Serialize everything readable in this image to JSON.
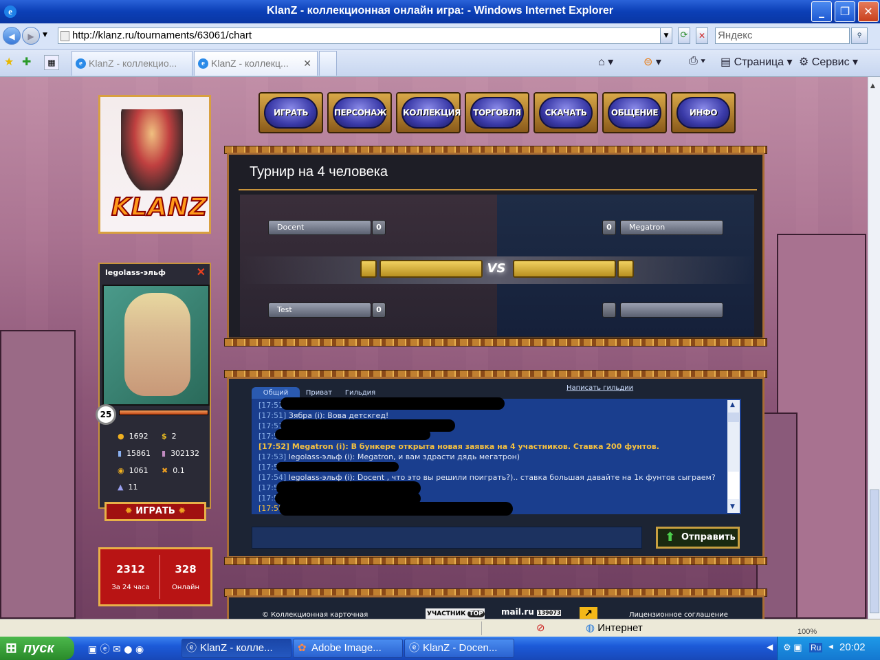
{
  "window": {
    "title": "KlanZ - коллекционная онлайн игра: - Windows Internet Explorer"
  },
  "address": {
    "url": "http://klanz.ru/tournaments/63061/chart",
    "search_placeholder": "Яндекс"
  },
  "tabs": [
    {
      "label": "KlanZ - коллекцио..."
    },
    {
      "label": "KlanZ - коллекц..."
    }
  ],
  "toolbar": {
    "page": "Страница",
    "service": "Сервис"
  },
  "game": {
    "menu": [
      "ИГРАТЬ",
      "ПЕРСОНАЖ",
      "КОЛЛЕКЦИЯ",
      "ТОРГОВЛЯ",
      "СКАЧАТЬ",
      "ОБЩЕНИЕ",
      "ИНФО"
    ],
    "logo": "KLANZ",
    "tournament_title": "Турнир на 4 человека",
    "bracket": {
      "left": [
        {
          "name": "Docent",
          "score": "0"
        },
        {
          "name": "Test",
          "score": "0"
        }
      ],
      "right": [
        {
          "name": "Megatron",
          "score": "0"
        },
        {
          "name": "",
          "score": ""
        }
      ],
      "vs": "VS"
    },
    "profile": {
      "name": "legolass-эльф",
      "level": "25",
      "stats": {
        "s1": "1692",
        "s2": "2",
        "s3": "15861",
        "s4": "302132",
        "s5": "1061",
        "s6": "0.1",
        "s7": "11"
      },
      "play_button": "ИГРАТЬ"
    },
    "counters": {
      "day_value": "2312",
      "day_label": "За 24 часа",
      "online_value": "328",
      "online_label": "Онлайн"
    },
    "chat": {
      "tabs": [
        "Общий",
        "Приват",
        "Гильдия"
      ],
      "guild_link": "Написать гильдии",
      "lines": [
        {
          "t": "[17:51]",
          "text": "",
          "hl": false
        },
        {
          "t": "[17:51]",
          "text": "Зябра (i): Вова детскгед!",
          "hl": false
        },
        {
          "t": "[17:51]",
          "text": "",
          "hl": false
        },
        {
          "t": "[17:51",
          "text": "",
          "hl": false
        },
        {
          "t": "[17:52]",
          "text": "Megatron (i): В бункере открыта новая заявка на 4 участников. Ставка 200 фунтов.",
          "hl": true
        },
        {
          "t": "[17:53]",
          "text": "legolass-эльф (i): Megatron, и вам здрасти дядь мегатрон)",
          "hl": false
        },
        {
          "t": "[17:53",
          "text": "",
          "hl": false
        },
        {
          "t": "[17:54]",
          "text": "legolass-эльф (i): Docent , что это вы решили поиграть?).. ставка большая давайте на 1к фунтов сыграем?",
          "hl": false
        },
        {
          "t": "[17:5",
          "text": "",
          "hl": false
        },
        {
          "t": "[17:5",
          "text": "",
          "hl": false
        },
        {
          "t": "[17:55",
          "text": "",
          "hl": false
        }
      ],
      "send_button": "Отправить"
    },
    "footer": {
      "copyright": "© Коллекционная карточная",
      "badge1": "УЧАСТНИК",
      "badge1b": "TOP",
      "badge2": "mail.ru",
      "badge2n": "139073",
      "license": "Лицензионное соглашение"
    }
  },
  "status": {
    "zone": "Интернет",
    "zoom": "100%"
  },
  "taskbar": {
    "start": "пуск",
    "items": [
      "KlanZ - колле...",
      "Adobe Image...",
      "KlanZ - Docen..."
    ],
    "lang": "Ru",
    "clock": "20:02"
  }
}
